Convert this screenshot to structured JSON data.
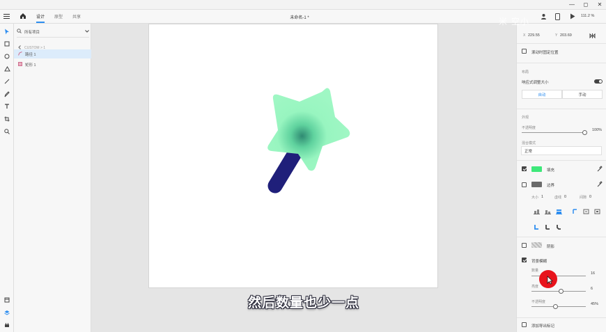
{
  "window": {
    "min": "—",
    "max": "◻",
    "close": "✕"
  },
  "topbar": {
    "tabs": [
      {
        "label": "设计",
        "active": true
      },
      {
        "label": "原型",
        "active": false
      },
      {
        "label": "共享",
        "active": false
      }
    ],
    "doc_title": "未命名-1 *",
    "zoom": "111.2 %"
  },
  "watermark": "米 空小",
  "layers": {
    "filter_label": "所有项目",
    "breadcrumb": "CUSTOM > 1",
    "items": [
      {
        "label": "路径 1",
        "selected": true
      },
      {
        "label": "矩形 1",
        "selected": false
      }
    ]
  },
  "subtitle": "然后数量也少一点",
  "props": {
    "x_label": "X",
    "x_value": "229.55",
    "y_label": "Y",
    "y_value": "203.69",
    "fixed_position_label": "滚动时固定位置",
    "responsive_section": "布局",
    "responsive_label": "响应式调整大小",
    "responsive_mode": {
      "auto": "自动",
      "manual": "手动"
    },
    "appearance_section": "外观",
    "opacity_label": "不透明度",
    "opacity_value": "100%",
    "blend_label": "混合模式",
    "blend_value": "正常",
    "fill_label": "填充",
    "fill_color": "#3ee87a",
    "border_label": "边界",
    "border_color": "#6b6b6b",
    "border_size_label": "大小",
    "border_size": "1",
    "dash_label": "虚线",
    "dash_value": "0",
    "gap_label": "间隙",
    "gap_value": "0",
    "shadow_label": "阴影",
    "bgblur_label": "背景模糊",
    "blur_amount_label": "数量",
    "blur_amount_value": "16",
    "brightness_label": "亮度",
    "brightness_value": "6",
    "blur_opacity_label": "不透明度",
    "blur_opacity_value": "45%",
    "export_label": "添加导出标记"
  },
  "colors": {
    "accent": "#2e8ef0",
    "star": "#98f5c0",
    "star_center": "#2f8a72",
    "handle": "#1f1f7a",
    "cursor": "#e8141c"
  }
}
